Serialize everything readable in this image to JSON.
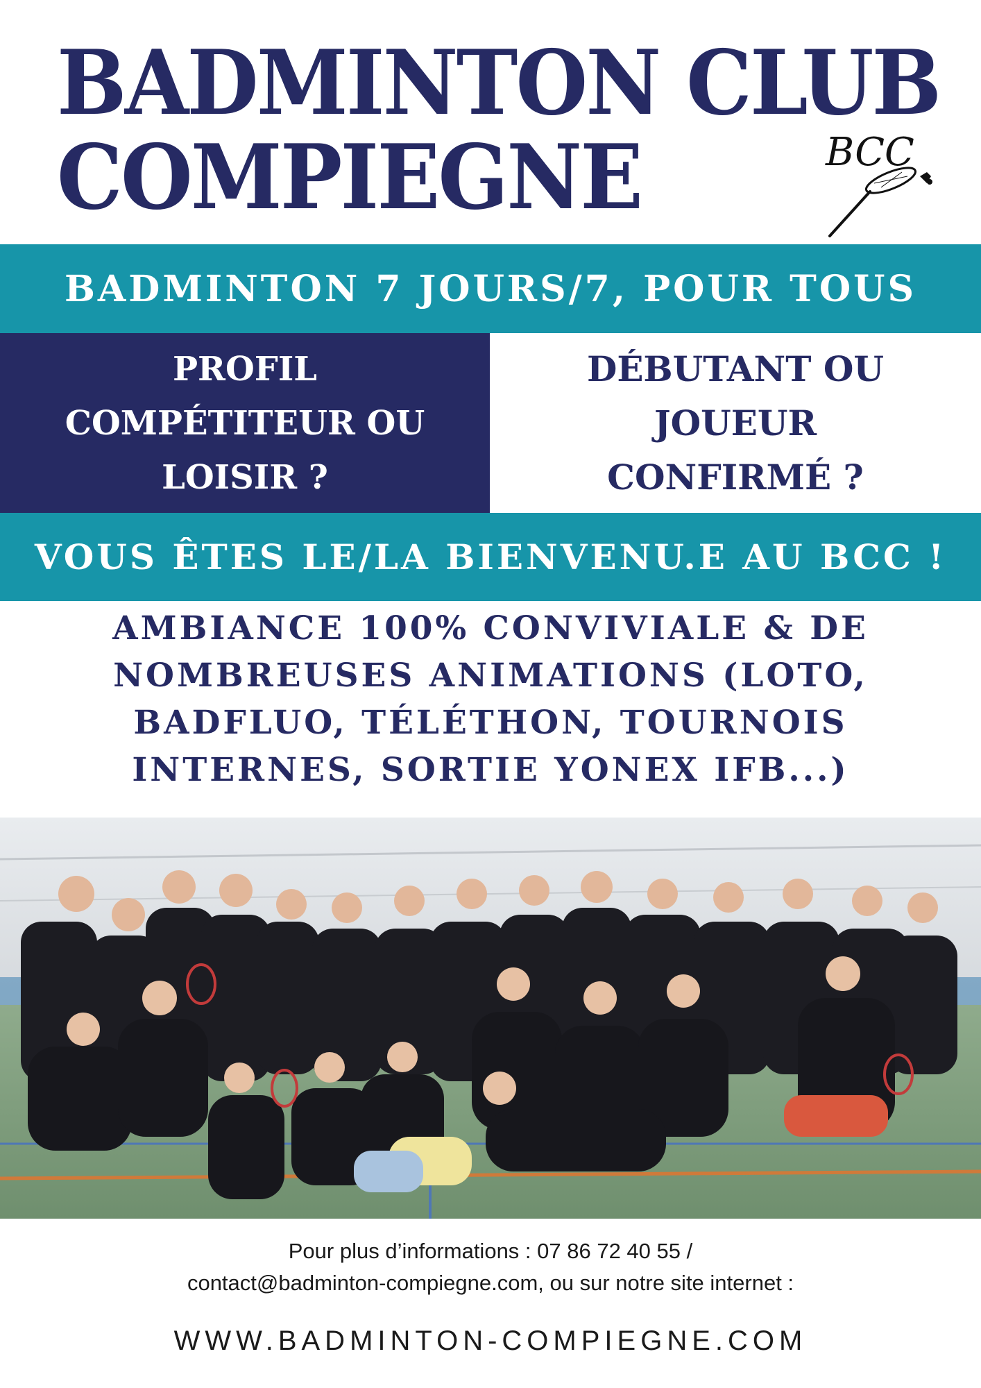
{
  "header": {
    "title_line1": "BADMINTON CLUB",
    "title_line2": "COMPIEGNE",
    "logo_text": "BCC"
  },
  "band_top": {
    "text": "BADMINTON 7 JOURS/7, POUR TOUS"
  },
  "profile_left": {
    "lines": [
      "PROFIL",
      "COMPÉTITEUR OU",
      "LOISIR ?"
    ]
  },
  "profile_right": {
    "lines": [
      "DÉBUTANT OU",
      "JOUEUR",
      "CONFIRMÉ ?"
    ]
  },
  "band_bottom": {
    "text": "VOUS ÊTES LE/LA BIENVENU.E AU BCC !"
  },
  "ambiance": {
    "lines": [
      "AMBIANCE 100% CONVIVIALE & DE",
      "NOMBREUSES ANIMATIONS (LOTO,",
      "BADFLUO, TÉLÉTHON, TOURNOIS",
      "INTERNES, SORTIE YONEX IFB...)"
    ]
  },
  "contact": {
    "line1": "Pour plus d’informations : 07 86 72 40 55 /",
    "line2": "contact@badminton-compiegne.com,  ou sur notre site internet :",
    "website": "WWW.BADMINTON-COMPIEGNE.COM"
  },
  "colors": {
    "navy": "#262a63",
    "teal": "#1795a9",
    "white": "#ffffff",
    "court_green": "#7fa07e",
    "jersey": "#1c1c22"
  },
  "icons": {
    "logo": "racket-shuttlecock-icon",
    "photo": "group-photo"
  }
}
